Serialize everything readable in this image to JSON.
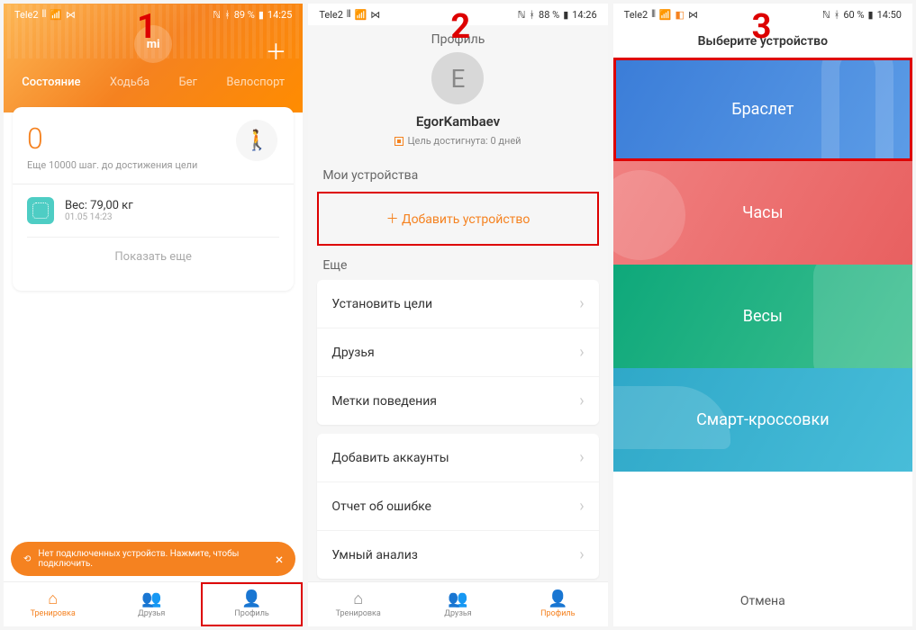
{
  "step_labels": [
    "1",
    "2",
    "3"
  ],
  "phone1": {
    "status": {
      "carrier": "Tele2",
      "signal": "⫴",
      "wifi": "📶",
      "link": "⋈",
      "nfc": "ℕ",
      "bt": "ᚼ",
      "battery_text": "89 %",
      "batt": "▮",
      "time": "14:25"
    },
    "logo": "mi",
    "tabs": [
      "Состояние",
      "Ходьба",
      "Бег",
      "Велоспорт"
    ],
    "steps": "0",
    "steps_goal": "Еще 10000 шаг. до достижения цели",
    "weight_label": "Вес: 79,00  кг",
    "weight_date": "01.05 14:23",
    "show_more": "Показать еще",
    "toast": "Нет подключенных устройств. Нажмите, чтобы подключить.",
    "nav": [
      "Тренировка",
      "Друзья",
      "Профиль"
    ]
  },
  "phone2": {
    "status": {
      "carrier": "Tele2",
      "signal": "⫴",
      "wifi": "📶",
      "link": "⋈",
      "nfc": "ℕ",
      "bt": "ᚼ",
      "battery_text": "88 %",
      "batt": "▮",
      "time": "14:26"
    },
    "title": "Профиль",
    "avatar_letter": "E",
    "name": "EgorKambaev",
    "goal_text": "Цель достигнута: 0 дней",
    "my_devices": "Мои устройства",
    "add_device": "＋ Добавить устройство",
    "more_section": "Еще",
    "rows1": [
      "Установить цели",
      "Друзья",
      "Метки поведения"
    ],
    "rows2": [
      "Добавить аккаунты",
      "Отчет об ошибке",
      "Умный анализ"
    ],
    "nav": [
      "Тренировка",
      "Друзья",
      "Профиль"
    ]
  },
  "phone3": {
    "status": {
      "carrier": "Tele2",
      "signal": "⫴",
      "wifi": "📶",
      "apps": "◧",
      "link": "⋈",
      "nfc": "ℕ",
      "bt": "ᚼ",
      "battery_text": "60 %",
      "batt": "▮",
      "time": "14:50"
    },
    "title": "Выберите устройство",
    "tiles": [
      "Браслет",
      "Часы",
      "Весы",
      "Смарт-кроссовки"
    ],
    "cancel": "Отмена"
  }
}
